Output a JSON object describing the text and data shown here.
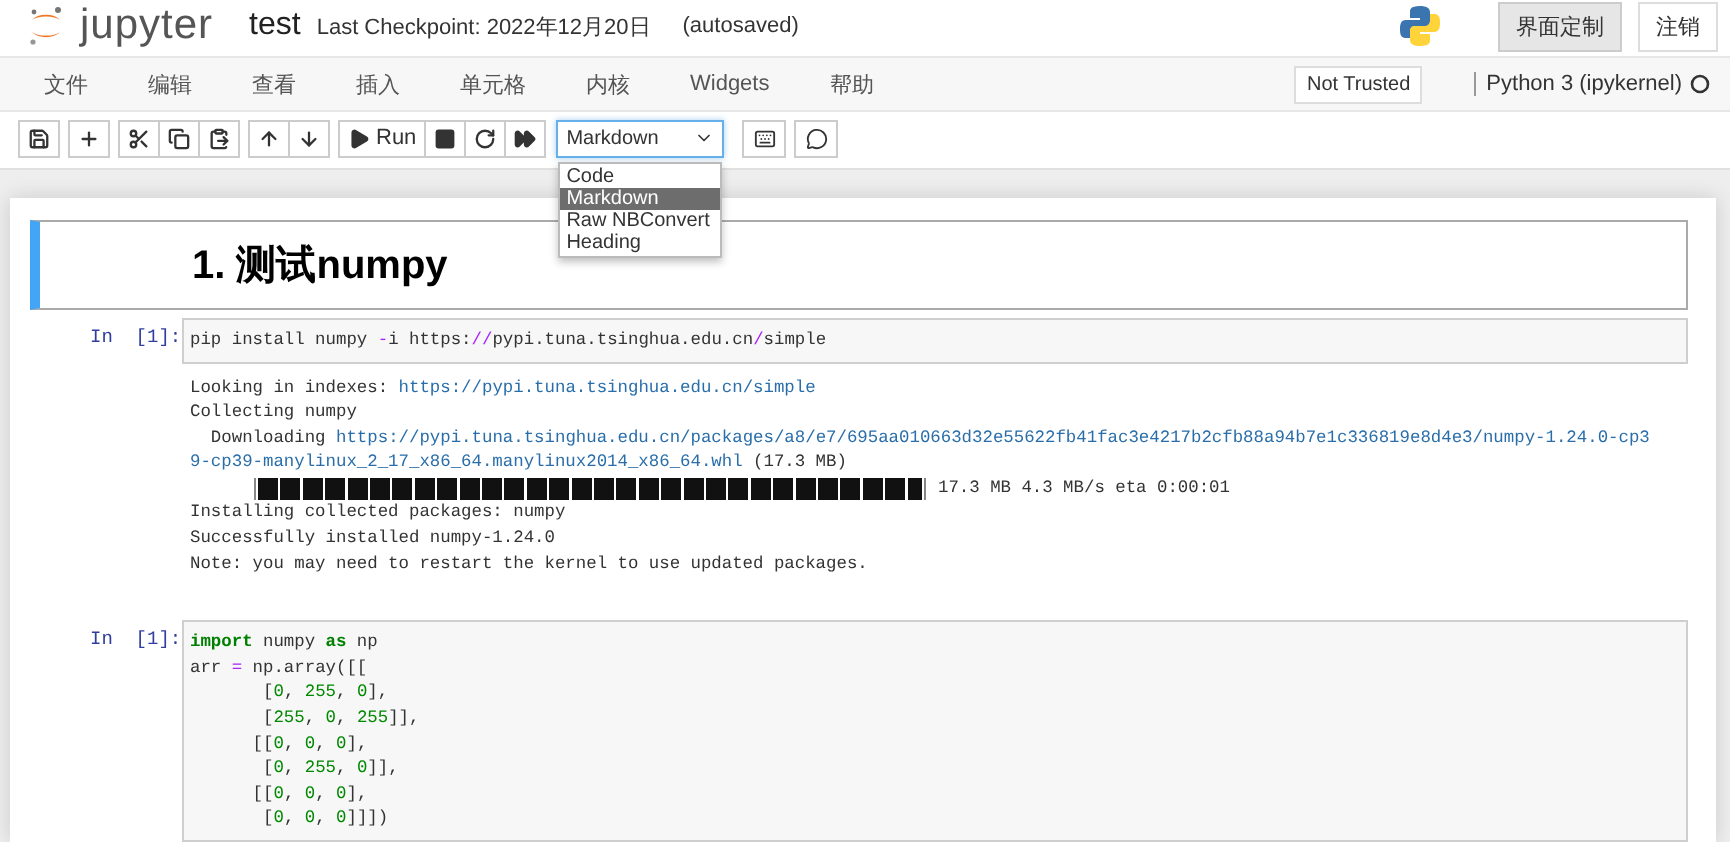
{
  "header": {
    "logo_text": "jupyter",
    "notebook_name": "test",
    "checkpoint": "Last Checkpoint: 2022年12月20日",
    "autosave": "(autosaved)",
    "buttons": [
      {
        "label": "界面定制",
        "selected": true
      },
      {
        "label": "注销",
        "selected": false
      }
    ]
  },
  "menu": [
    "文件",
    "编辑",
    "查看",
    "插入",
    "单元格",
    "内核",
    "Widgets",
    "帮助"
  ],
  "trust": "Not Trusted",
  "kernel": {
    "name": "Python 3 (ipykernel)",
    "busy": false
  },
  "toolbar": {
    "buttons": [
      {
        "kind": "save"
      },
      {
        "kind": "add"
      },
      {
        "kind": "cut"
      },
      {
        "kind": "copy"
      },
      {
        "kind": "paste"
      },
      {
        "kind": "up"
      },
      {
        "kind": "down"
      },
      {
        "kind": "run",
        "label": "Run"
      },
      {
        "kind": "stop"
      },
      {
        "kind": "restart"
      },
      {
        "kind": "run-all"
      },
      {
        "kind": "keyboard"
      },
      {
        "kind": "comment"
      }
    ],
    "cell_type": {
      "value": "Markdown",
      "expanded": true,
      "options": [
        {
          "label": "Code",
          "selected": false
        },
        {
          "label": "Markdown",
          "selected": true
        },
        {
          "label": "Raw NBConvert",
          "selected": false
        },
        {
          "label": "Heading",
          "selected": false
        }
      ]
    }
  },
  "cells": [
    {
      "kind": "markdown",
      "selected": true,
      "heading": "1. 测试numpy"
    },
    {
      "kind": "code",
      "prompt": "In  [1]:",
      "code": [
        [
          {
            "t": "pip install numpy ",
            "kind": "plain"
          },
          {
            "t": "-",
            "kind": "op"
          },
          {
            "t": "i https:",
            "kind": "plain"
          },
          {
            "t": "//",
            "kind": "op"
          },
          {
            "t": "pypi.tuna.tsinghua.edu.cn",
            "kind": "plain"
          },
          {
            "t": "/",
            "kind": "op"
          },
          {
            "t": "simple",
            "kind": "plain"
          }
        ]
      ],
      "output": [
        {
          "kind": "text",
          "parts": [
            {
              "t": "Looking in indexes: ",
              "kind": "text"
            },
            {
              "t": "https://pypi.tuna.tsinghua.edu.cn/simple",
              "kind": "link"
            }
          ]
        },
        {
          "kind": "text",
          "parts": [
            {
              "t": "Collecting numpy",
              "kind": "text"
            }
          ]
        },
        {
          "kind": "text",
          "parts": [
            {
              "t": "  Downloading ",
              "kind": "text"
            },
            {
              "t": "https://pypi.tuna.tsinghua.edu.cn/packages/a8/e7/695aa010663d32e55622fb41fac3e4217b2cfb88a94b7e1c336819e8d4e3/numpy-1.24.0-cp3",
              "kind": "link"
            }
          ]
        },
        {
          "kind": "text",
          "parts": [
            {
              "t": "9-cp39-manylinux_2_17_x86_64.manylinux2014_x86_64.whl",
              "kind": "link"
            },
            {
              "t": " (17.3 MB)",
              "kind": "text"
            }
          ]
        },
        {
          "kind": "progress",
          "level": 1,
          "reading": "17.3 MB 4.3 MB/s eta 0:00:01"
        },
        {
          "kind": "text",
          "parts": [
            {
              "t": "Installing collected packages: numpy",
              "kind": "text"
            }
          ]
        },
        {
          "kind": "text",
          "parts": [
            {
              "t": "Successfully installed numpy-1.24.0",
              "kind": "text"
            }
          ]
        },
        {
          "kind": "text",
          "parts": [
            {
              "t": "Note: you may need to restart the kernel to use updated packages.",
              "kind": "text"
            }
          ]
        }
      ]
    },
    {
      "kind": "code",
      "prompt": "In  [1]:",
      "code": [
        [
          {
            "t": "import",
            "kind": "kw"
          },
          {
            "t": " numpy ",
            "kind": "plain"
          },
          {
            "t": "as",
            "kind": "kw"
          },
          {
            "t": " np",
            "kind": "plain"
          }
        ],
        [
          {
            "t": "arr ",
            "kind": "plain"
          },
          {
            "t": "=",
            "kind": "op"
          },
          {
            "t": " np.array([[",
            "kind": "plain"
          }
        ],
        [
          {
            "t": "       [",
            "kind": "plain"
          },
          {
            "t": "0",
            "kind": "num"
          },
          {
            "t": ", ",
            "kind": "plain"
          },
          {
            "t": "255",
            "kind": "num"
          },
          {
            "t": ", ",
            "kind": "plain"
          },
          {
            "t": "0",
            "kind": "num"
          },
          {
            "t": "],",
            "kind": "plain"
          }
        ],
        [
          {
            "t": "       [",
            "kind": "plain"
          },
          {
            "t": "255",
            "kind": "num"
          },
          {
            "t": ", ",
            "kind": "plain"
          },
          {
            "t": "0",
            "kind": "num"
          },
          {
            "t": ", ",
            "kind": "plain"
          },
          {
            "t": "255",
            "kind": "num"
          },
          {
            "t": "]],",
            "kind": "plain"
          }
        ],
        [
          {
            "t": "      [[",
            "kind": "plain"
          },
          {
            "t": "0",
            "kind": "num"
          },
          {
            "t": ", ",
            "kind": "plain"
          },
          {
            "t": "0",
            "kind": "num"
          },
          {
            "t": ", ",
            "kind": "plain"
          },
          {
            "t": "0",
            "kind": "num"
          },
          {
            "t": "],",
            "kind": "plain"
          }
        ],
        [
          {
            "t": "       [",
            "kind": "plain"
          },
          {
            "t": "0",
            "kind": "num"
          },
          {
            "t": ", ",
            "kind": "plain"
          },
          {
            "t": "255",
            "kind": "num"
          },
          {
            "t": ", ",
            "kind": "plain"
          },
          {
            "t": "0",
            "kind": "num"
          },
          {
            "t": "]],",
            "kind": "plain"
          }
        ],
        [
          {
            "t": "      [[",
            "kind": "plain"
          },
          {
            "t": "0",
            "kind": "num"
          },
          {
            "t": ", ",
            "kind": "plain"
          },
          {
            "t": "0",
            "kind": "num"
          },
          {
            "t": ", ",
            "kind": "plain"
          },
          {
            "t": "0",
            "kind": "num"
          },
          {
            "t": "],",
            "kind": "plain"
          }
        ],
        [
          {
            "t": "       [",
            "kind": "plain"
          },
          {
            "t": "0",
            "kind": "num"
          },
          {
            "t": ", ",
            "kind": "plain"
          },
          {
            "t": "0",
            "kind": "num"
          },
          {
            "t": ", ",
            "kind": "plain"
          },
          {
            "t": "0",
            "kind": "num"
          },
          {
            "t": "]]])",
            "kind": "plain"
          }
        ]
      ]
    }
  ]
}
